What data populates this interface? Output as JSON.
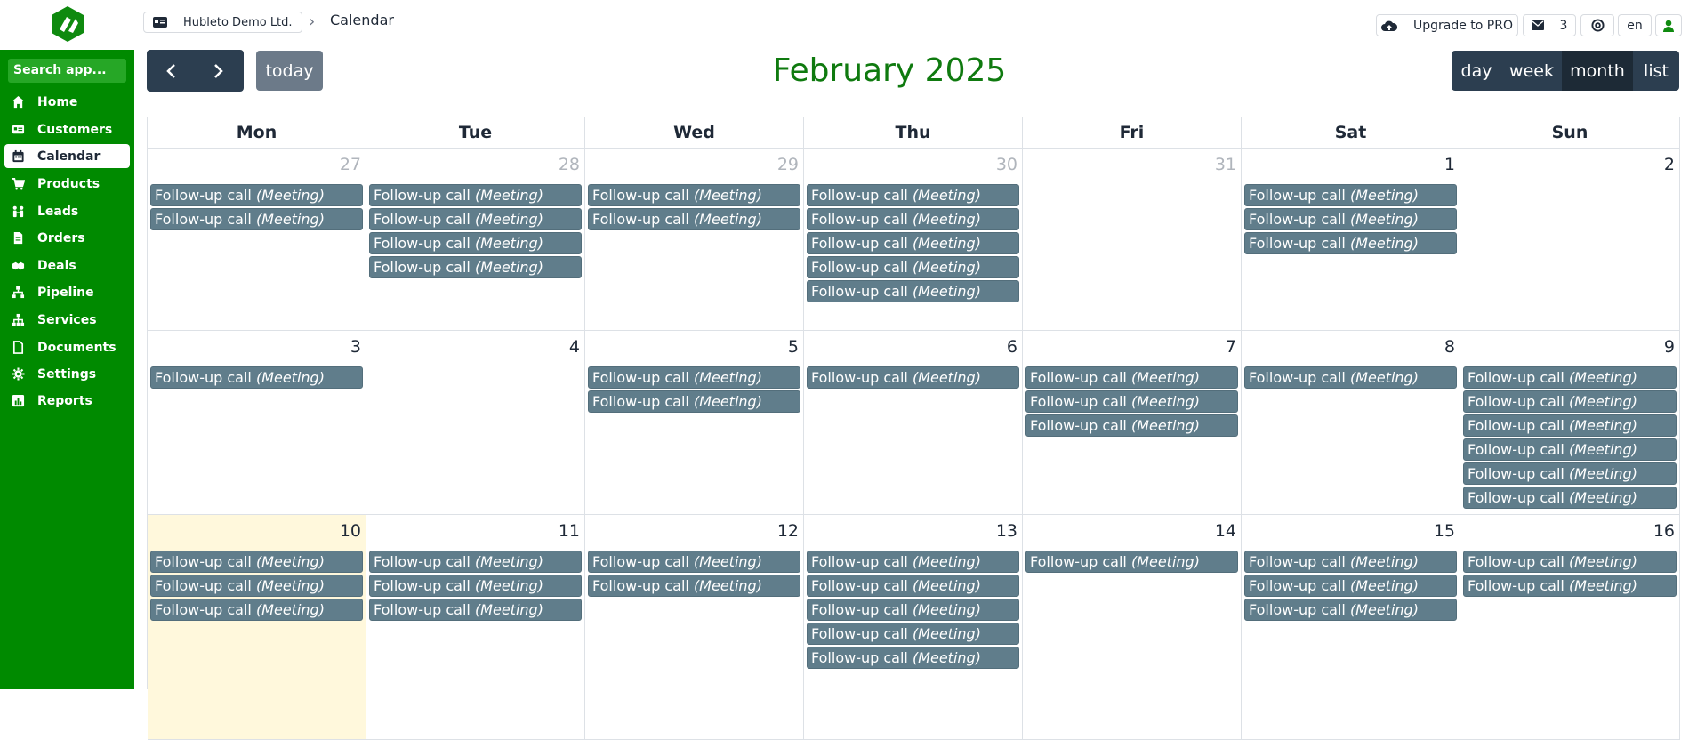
{
  "sidebar": {
    "search_placeholder": "Search app...",
    "items": [
      {
        "label": "Home",
        "icon": "home-icon"
      },
      {
        "label": "Customers",
        "icon": "id-card-icon"
      },
      {
        "label": "Calendar",
        "icon": "calendar-icon",
        "active": true
      },
      {
        "label": "Products",
        "icon": "cart-icon"
      },
      {
        "label": "Leads",
        "icon": "people-icon"
      },
      {
        "label": "Orders",
        "icon": "file-icon"
      },
      {
        "label": "Deals",
        "icon": "handshake-icon"
      },
      {
        "label": "Pipeline",
        "icon": "sitemap-icon"
      },
      {
        "label": "Services",
        "icon": "network-icon"
      },
      {
        "label": "Documents",
        "icon": "document-icon"
      },
      {
        "label": "Settings",
        "icon": "gear-icon"
      },
      {
        "label": "Reports",
        "icon": "chart-icon"
      }
    ]
  },
  "header": {
    "company": "Hubleto Demo Ltd.",
    "page": "Calendar",
    "upgrade_label": "Upgrade to PRO",
    "mail_count": "3",
    "language": "en"
  },
  "calendar": {
    "title": "February 2025",
    "today_label": "today",
    "views": [
      "day",
      "week",
      "month",
      "list"
    ],
    "active_view": "month",
    "weekdays": [
      "Mon",
      "Tue",
      "Wed",
      "Thu",
      "Fri",
      "Sat",
      "Sun"
    ],
    "event_title": "Follow-up call",
    "event_type": "(Meeting)",
    "weeks": [
      [
        {
          "day": "27",
          "other": true,
          "events": 2
        },
        {
          "day": "28",
          "other": true,
          "events": 4
        },
        {
          "day": "29",
          "other": true,
          "events": 2
        },
        {
          "day": "30",
          "other": true,
          "events": 5
        },
        {
          "day": "31",
          "other": true,
          "events": 0
        },
        {
          "day": "1",
          "events": 3
        },
        {
          "day": "2",
          "events": 0
        }
      ],
      [
        {
          "day": "3",
          "events": 1
        },
        {
          "day": "4",
          "events": 0
        },
        {
          "day": "5",
          "events": 2
        },
        {
          "day": "6",
          "events": 1
        },
        {
          "day": "7",
          "events": 3
        },
        {
          "day": "8",
          "events": 1
        },
        {
          "day": "9",
          "events": 6
        }
      ],
      [
        {
          "day": "10",
          "today": true,
          "events": 3
        },
        {
          "day": "11",
          "events": 3
        },
        {
          "day": "12",
          "events": 2
        },
        {
          "day": "13",
          "events": 5
        },
        {
          "day": "14",
          "events": 1
        },
        {
          "day": "15",
          "events": 3
        },
        {
          "day": "16",
          "events": 2
        }
      ]
    ]
  },
  "colors": {
    "brand_green": "#008a00",
    "title_green": "#0f7a0f",
    "event_bg": "#607d8b",
    "toolbar_dark": "#2c3e50",
    "today_bg": "#fff8dc"
  }
}
